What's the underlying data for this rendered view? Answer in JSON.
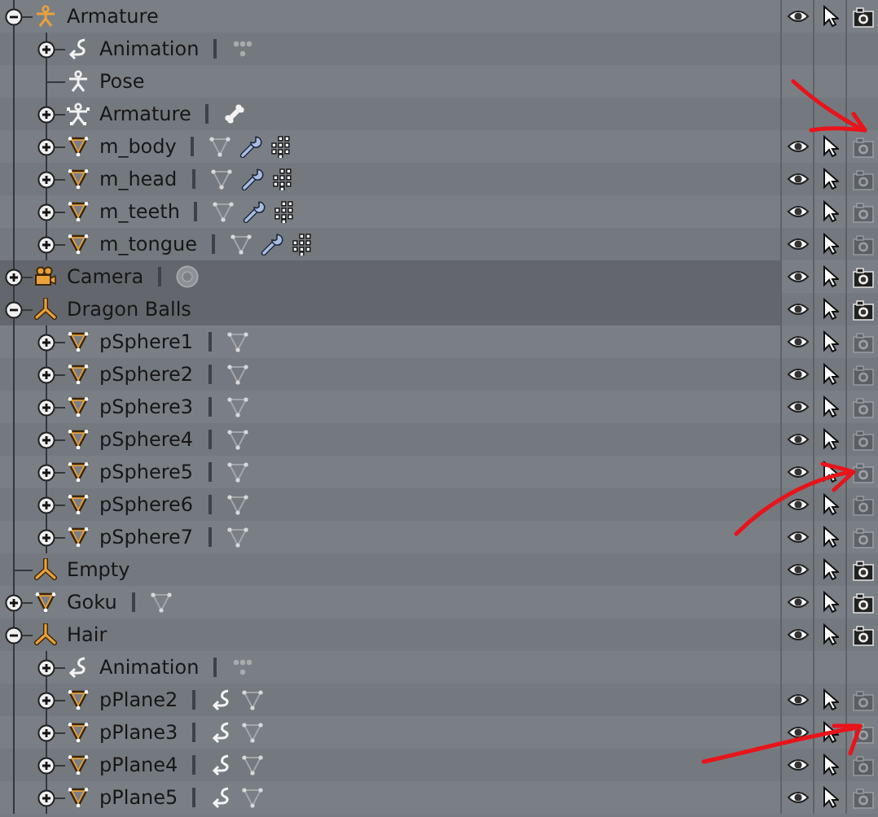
{
  "outliner": {
    "items": [
      {
        "name": "Armature",
        "kind": "armature",
        "expanded": true,
        "selected": false,
        "restrict": {
          "visible": true,
          "selectable": true,
          "renderable": true
        },
        "children": [
          {
            "name": "Animation",
            "kind": "animation",
            "expanded": false,
            "selected": false,
            "data_items": [
              {
                "kind": "action"
              }
            ]
          },
          {
            "name": "Pose",
            "kind": "pose",
            "selected": false
          },
          {
            "name": "Armature",
            "kind": "armature-data",
            "expanded": false,
            "selected": false,
            "data_items": [
              {
                "kind": "bone"
              }
            ]
          },
          {
            "name": "m_body",
            "kind": "mesh",
            "expanded": false,
            "selected": false,
            "data_items": [
              {
                "kind": "mesh-data"
              },
              {
                "kind": "modifier"
              },
              {
                "kind": "vertex-groups"
              }
            ],
            "restrict": {
              "visible": true,
              "selectable": true,
              "renderable": false
            }
          },
          {
            "name": "m_head",
            "kind": "mesh",
            "expanded": false,
            "selected": false,
            "data_items": [
              {
                "kind": "mesh-data"
              },
              {
                "kind": "modifier"
              },
              {
                "kind": "vertex-groups"
              }
            ],
            "restrict": {
              "visible": true,
              "selectable": true,
              "renderable": false
            }
          },
          {
            "name": "m_teeth",
            "kind": "mesh",
            "expanded": false,
            "selected": false,
            "data_items": [
              {
                "kind": "mesh-data"
              },
              {
                "kind": "modifier"
              },
              {
                "kind": "vertex-groups"
              }
            ],
            "restrict": {
              "visible": true,
              "selectable": true,
              "renderable": false
            }
          },
          {
            "name": "m_tongue",
            "kind": "mesh",
            "expanded": false,
            "selected": false,
            "data_items": [
              {
                "kind": "mesh-data"
              },
              {
                "kind": "modifier"
              },
              {
                "kind": "vertex-groups"
              }
            ],
            "restrict": {
              "visible": true,
              "selectable": true,
              "renderable": false
            }
          }
        ]
      },
      {
        "name": "Camera",
        "kind": "camera",
        "expanded": false,
        "selected": true,
        "data_items": [
          {
            "kind": "camera-data"
          }
        ],
        "restrict": {
          "visible": true,
          "selectable": true,
          "renderable": true
        }
      },
      {
        "name": "Dragon Balls",
        "kind": "empty",
        "expanded": true,
        "selected": true,
        "restrict": {
          "visible": true,
          "selectable": true,
          "renderable": true
        },
        "children": [
          {
            "name": "pSphere1",
            "kind": "mesh",
            "expanded": false,
            "selected": false,
            "data_items": [
              {
                "kind": "mesh-data"
              }
            ],
            "restrict": {
              "visible": true,
              "selectable": true,
              "renderable": false
            }
          },
          {
            "name": "pSphere2",
            "kind": "mesh",
            "expanded": false,
            "selected": false,
            "data_items": [
              {
                "kind": "mesh-data"
              }
            ],
            "restrict": {
              "visible": true,
              "selectable": true,
              "renderable": false
            }
          },
          {
            "name": "pSphere3",
            "kind": "mesh",
            "expanded": false,
            "selected": false,
            "data_items": [
              {
                "kind": "mesh-data"
              }
            ],
            "restrict": {
              "visible": true,
              "selectable": true,
              "renderable": false
            }
          },
          {
            "name": "pSphere4",
            "kind": "mesh",
            "expanded": false,
            "selected": false,
            "data_items": [
              {
                "kind": "mesh-data"
              }
            ],
            "restrict": {
              "visible": true,
              "selectable": true,
              "renderable": false
            }
          },
          {
            "name": "pSphere5",
            "kind": "mesh",
            "expanded": false,
            "selected": false,
            "data_items": [
              {
                "kind": "mesh-data"
              }
            ],
            "restrict": {
              "visible": true,
              "selectable": true,
              "renderable": false
            }
          },
          {
            "name": "pSphere6",
            "kind": "mesh",
            "expanded": false,
            "selected": false,
            "data_items": [
              {
                "kind": "mesh-data"
              }
            ],
            "restrict": {
              "visible": true,
              "selectable": true,
              "renderable": false
            }
          },
          {
            "name": "pSphere7",
            "kind": "mesh",
            "expanded": false,
            "selected": false,
            "data_items": [
              {
                "kind": "mesh-data"
              }
            ],
            "restrict": {
              "visible": true,
              "selectable": true,
              "renderable": false
            }
          }
        ]
      },
      {
        "name": "Empty",
        "kind": "empty",
        "selected": false,
        "restrict": {
          "visible": true,
          "selectable": true,
          "renderable": true
        }
      },
      {
        "name": "Goku",
        "kind": "mesh",
        "expanded": false,
        "selected": false,
        "data_items": [
          {
            "kind": "mesh-data"
          }
        ],
        "restrict": {
          "visible": true,
          "selectable": true,
          "renderable": true
        }
      },
      {
        "name": "Hair",
        "kind": "empty",
        "expanded": true,
        "selected": false,
        "restrict": {
          "visible": true,
          "selectable": true,
          "renderable": true
        },
        "children": [
          {
            "name": "Animation",
            "kind": "animation",
            "expanded": false,
            "selected": false,
            "data_items": [
              {
                "kind": "action"
              }
            ]
          },
          {
            "name": "pPlane2",
            "kind": "mesh",
            "expanded": false,
            "selected": false,
            "data_items": [
              {
                "kind": "animation"
              },
              {
                "kind": "mesh-data"
              }
            ],
            "restrict": {
              "visible": true,
              "selectable": true,
              "renderable": false
            }
          },
          {
            "name": "pPlane3",
            "kind": "mesh",
            "expanded": false,
            "selected": false,
            "data_items": [
              {
                "kind": "animation"
              },
              {
                "kind": "mesh-data"
              }
            ],
            "restrict": {
              "visible": true,
              "selectable": true,
              "renderable": false
            }
          },
          {
            "name": "pPlane4",
            "kind": "mesh",
            "expanded": false,
            "selected": false,
            "data_items": [
              {
                "kind": "animation"
              },
              {
                "kind": "mesh-data"
              }
            ],
            "restrict": {
              "visible": true,
              "selectable": true,
              "renderable": false
            }
          },
          {
            "name": "pPlane5",
            "kind": "mesh",
            "expanded": false,
            "selected": false,
            "data_items": [
              {
                "kind": "animation"
              },
              {
                "kind": "mesh-data"
              }
            ],
            "restrict": {
              "visible": true,
              "selectable": true,
              "renderable": false
            }
          }
        ]
      }
    ]
  },
  "annotations": [
    {
      "kind": "arrow"
    },
    {
      "kind": "arrow"
    },
    {
      "kind": "arrow"
    }
  ]
}
